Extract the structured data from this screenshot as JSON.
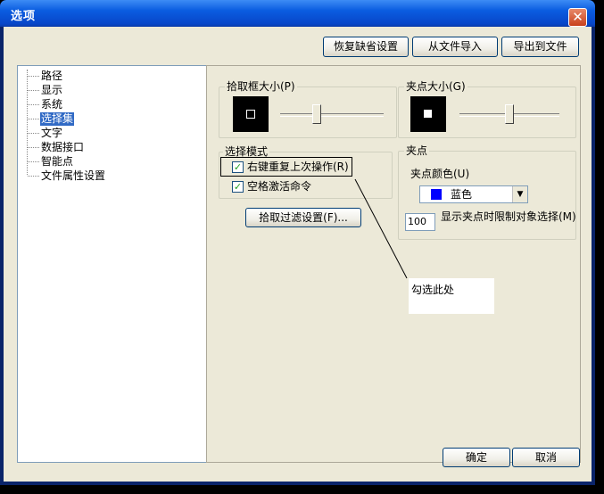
{
  "window": {
    "title": "选项",
    "close_glyph": "✕"
  },
  "top_buttons": {
    "restore": "恢复缺省设置",
    "import": "从文件导入",
    "export": "导出到文件"
  },
  "tree": {
    "items": [
      "路径",
      "显示",
      "系统",
      "选择集",
      "文字",
      "数据接口",
      "智能点",
      "文件属性设置"
    ],
    "selected": "选择集"
  },
  "pickbox": {
    "label": "拾取框大小(P)",
    "level": 0.35
  },
  "grip_size": {
    "label": "夹点大小(G)",
    "level": 0.5
  },
  "selection_mode": {
    "label": "选择模式",
    "repeat_last": {
      "label": "右键重复上次操作(R)",
      "checked": true
    },
    "space_activate": {
      "label": "空格激活命令",
      "checked": true
    }
  },
  "filter_button": "拾取过滤设置(F)...",
  "grip": {
    "label": "夹点",
    "color_label": "夹点颜色(U)",
    "color_value": "蓝色",
    "color_hex": "#0000ff",
    "limit_value": "100",
    "limit_label": "显示夹点时限制对象选择(M)"
  },
  "callout": {
    "text": "勾选此处"
  },
  "bottom_buttons": {
    "ok": "确定",
    "cancel": "取消"
  }
}
